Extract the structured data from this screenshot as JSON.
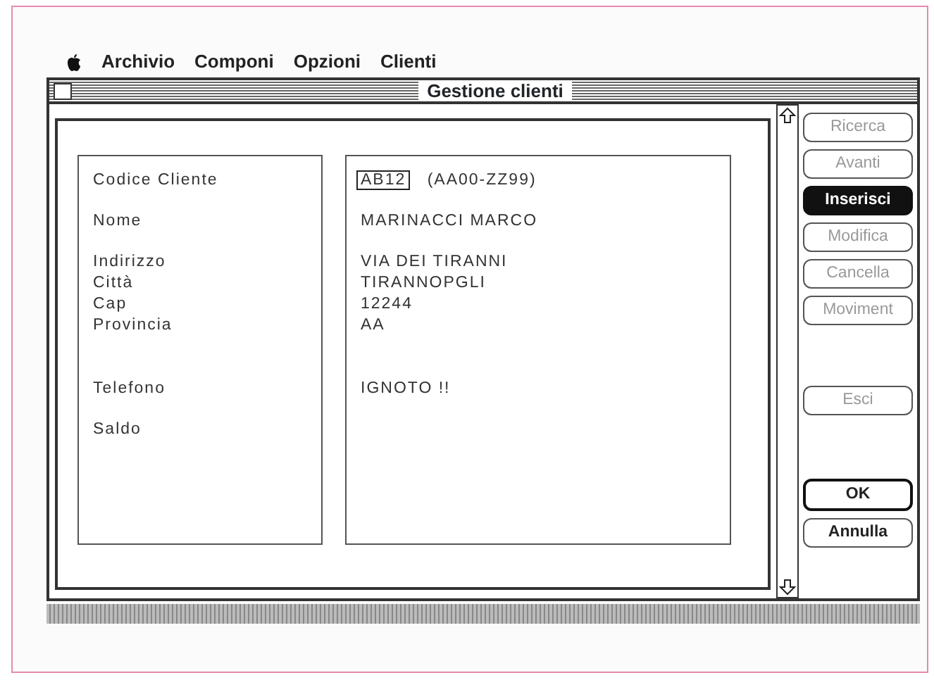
{
  "menu_bar": {
    "items": [
      "Archivio",
      "Componi",
      "Opzioni",
      "Clienti"
    ]
  },
  "window": {
    "title": "Gestione clienti"
  },
  "form": {
    "groups": [
      [
        {
          "label": "Codice Cliente",
          "value": "AB12",
          "hint": "(AA00-ZZ99)"
        }
      ],
      [
        {
          "label": "Nome",
          "value": "MARINACCI MARCO"
        }
      ],
      [
        {
          "label": "Indirizzo",
          "value": "VIA DEI TIRANNI"
        },
        {
          "label": "Città",
          "value": "TIRANNOPGLI"
        },
        {
          "label": "Cap",
          "value": "12244"
        },
        {
          "label": "Provincia",
          "value": "AA"
        }
      ],
      [
        {
          "label": "Telefono",
          "value": "IGNOTO !!"
        }
      ],
      [
        {
          "label": "Saldo"
        }
      ]
    ]
  },
  "buttons": [
    {
      "label": "Ricerca",
      "kind": "action",
      "disabled": true,
      "selected": false
    },
    {
      "label": "Avanti",
      "kind": "action",
      "disabled": true,
      "selected": false
    },
    {
      "label": "Inserisci",
      "kind": "action",
      "disabled": false,
      "selected": true
    },
    {
      "label": "Modifica",
      "kind": "action",
      "disabled": true,
      "selected": false
    },
    {
      "label": "Cancella",
      "kind": "action",
      "disabled": true,
      "selected": false
    },
    {
      "label": "Moviment",
      "kind": "action",
      "disabled": true,
      "selected": false
    },
    {
      "label": "Esci",
      "kind": "spaced",
      "disabled": true,
      "selected": false
    },
    {
      "label": "OK",
      "kind": "default",
      "disabled": false,
      "selected": false
    },
    {
      "label": "Annulla",
      "kind": "action",
      "disabled": false,
      "selected": false
    }
  ]
}
